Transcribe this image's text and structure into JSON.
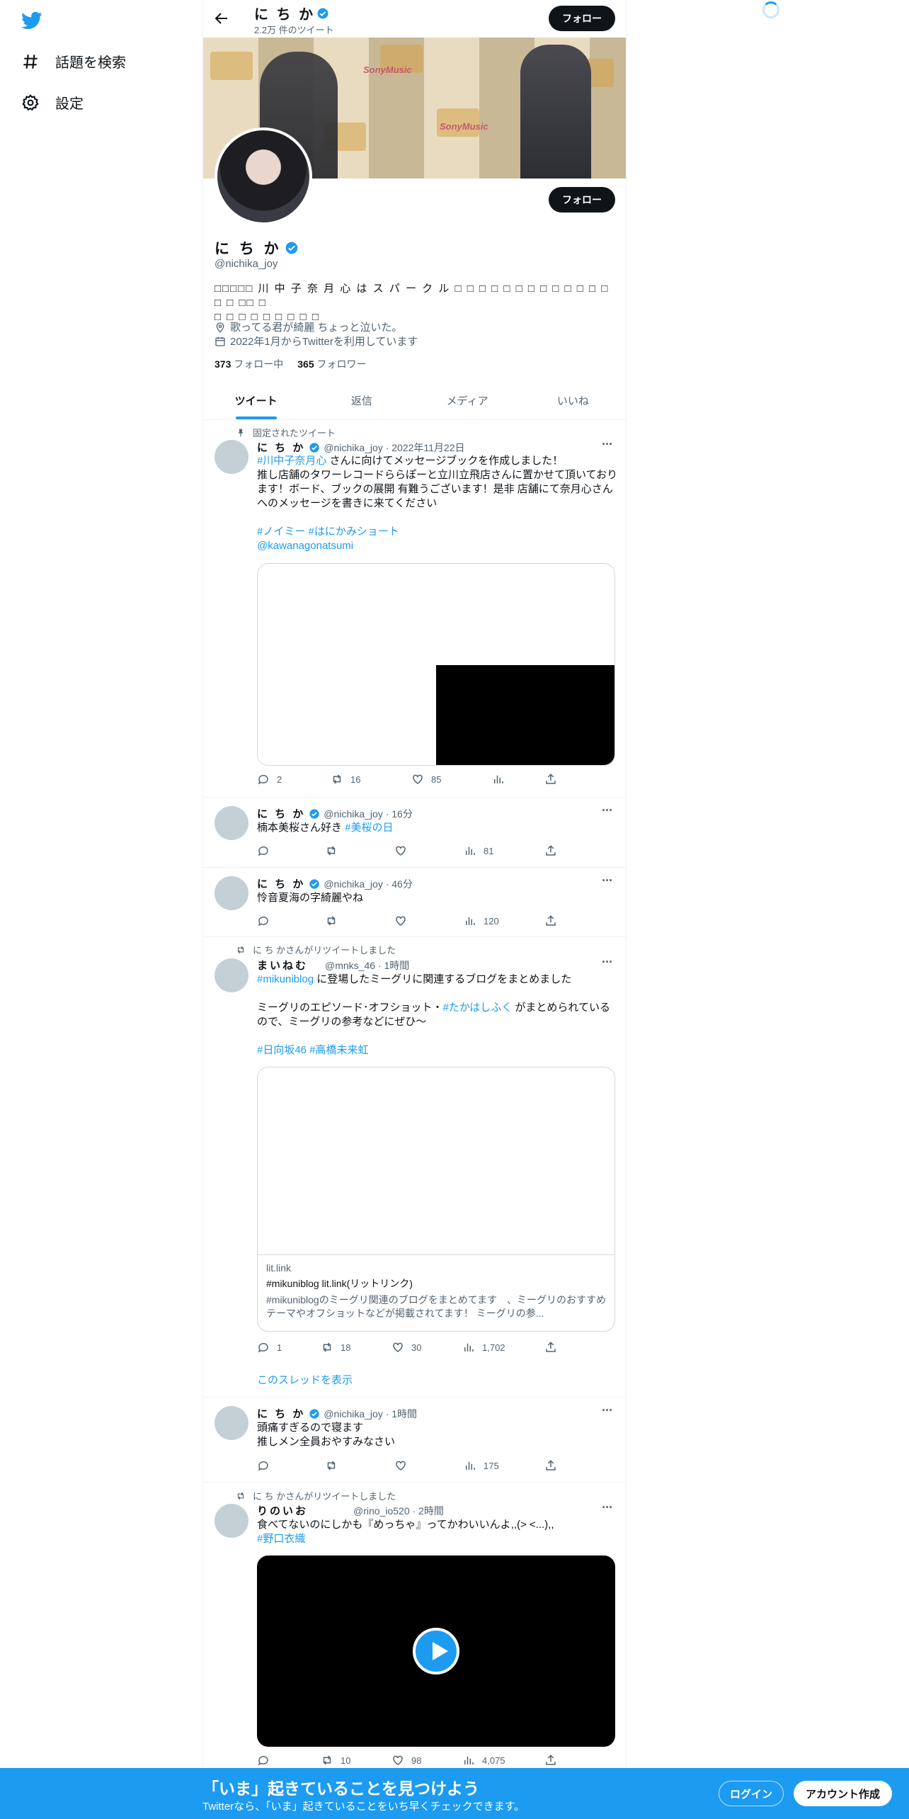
{
  "nav": {
    "explore_label": "話題を検索",
    "settings_label": "設定"
  },
  "header": {
    "name": "に ち か",
    "tweet_count": "2.2万 件のツイート",
    "follow_label": "フォロー"
  },
  "banner": {
    "brand_text": "SonyMusic"
  },
  "profile": {
    "name": "に ち か",
    "handle": "@nichika_joy",
    "follow_label": "フォロー",
    "bio_line1": "□□□□□ 川 中 子 奈 月 心 は ス パ ー ク ル □ □ □ □ □ □ □ □ □ □ □ □ □ □ □ □□ □",
    "bio_line2": "□ □ □ □ □ □ □ □ □",
    "location": "歌ってる君が綺麗 ちょっと泣いた。",
    "joined": "2022年1月からTwitterを利用しています",
    "following_count": "373",
    "following_label": "フォロー中",
    "followers_count": "365",
    "followers_label": "フォロワー"
  },
  "tabs": [
    "ツイート",
    "返信",
    "メディア",
    "いいね"
  ],
  "tweets": {
    "t1": {
      "context": "固定されたツイート",
      "name": "に ち か",
      "meta": "@nichika_joy · 2022年11月22日",
      "link1": "#川中子奈月心",
      "text1": " さんに向けてメッセージブックを作成しました！",
      "text2": "推し店舗のタワーレコードららぽーと立川立飛店さんに置かせて頂いております！ボード、ブックの展開 有難うございます！是非 店舗にて奈月心さんへのメッセージを書きに来てください",
      "tags": "#ノイミー  #はにかみショート",
      "mention": "@kawanagonatsumi",
      "replies": "2",
      "retweets": "16",
      "likes": "85"
    },
    "t2": {
      "name": "に ち か",
      "meta": "@nichika_joy · 16分",
      "text": "楠本美桜さん好き ",
      "link": "#美桜の日",
      "views": "81"
    },
    "t3": {
      "name": "に ち か",
      "meta": "@nichika_joy · 46分",
      "text": "怜音夏海の字綺麗やね",
      "views": "120"
    },
    "t4": {
      "context": "に ち かさんがリツイートしました",
      "name": "まいねむ",
      "meta": "@mnks_46 · 1時間",
      "link1": "#mikuniblog",
      "text1": " に登場したミーグリに関連するブログをまとめました",
      "text2a": "ミーグリのエピソード･オフショット・",
      "link2": "#たかはしふく",
      "text2b": " がまとめられているので、ミーグリの参考などにぜひ〜",
      "tags": "#日向坂46 #高橋未来虹",
      "card_domain": "lit.link",
      "card_title": "#mikuniblog lit.link(リットリンク)",
      "card_desc": "#mikuniblogのミーグリ関連のブログをまとめてます　、ミーグリのおすすめテーマやオフショットなどが掲載されてます！ ミーグリの参...",
      "replies": "1",
      "retweets": "18",
      "likes": "30",
      "views": "1,702",
      "show_thread": "このスレッドを表示"
    },
    "t5": {
      "name": "に ち か",
      "meta": "@nichika_joy · 1時間",
      "text1": "頭痛すぎるので寝ます",
      "text2": "推しメン全員おやすみなさい",
      "views": "175"
    },
    "t6": {
      "context": "に ち かさんがリツイートしました",
      "name": "りのいお",
      "meta": "@rino_io520 · 2時間",
      "text": "食べてないのにしかも『めっちゃ』ってかわいいんよ,,(> <...),,",
      "link": "#野口衣織",
      "replies": "",
      "retweets": "10",
      "likes": "98",
      "views": "4,075"
    }
  },
  "bottom_bar": {
    "headline": "「いま」起きていることを見つけよう",
    "sub": "Twitterなら、「いま」起きていることをいち早くチェックできます。",
    "login_label": "ログイン",
    "signup_label": "アカウント作成"
  },
  "colors": {
    "accent": "#1d9bf0",
    "text": "#0f1419",
    "muted": "#536471"
  }
}
